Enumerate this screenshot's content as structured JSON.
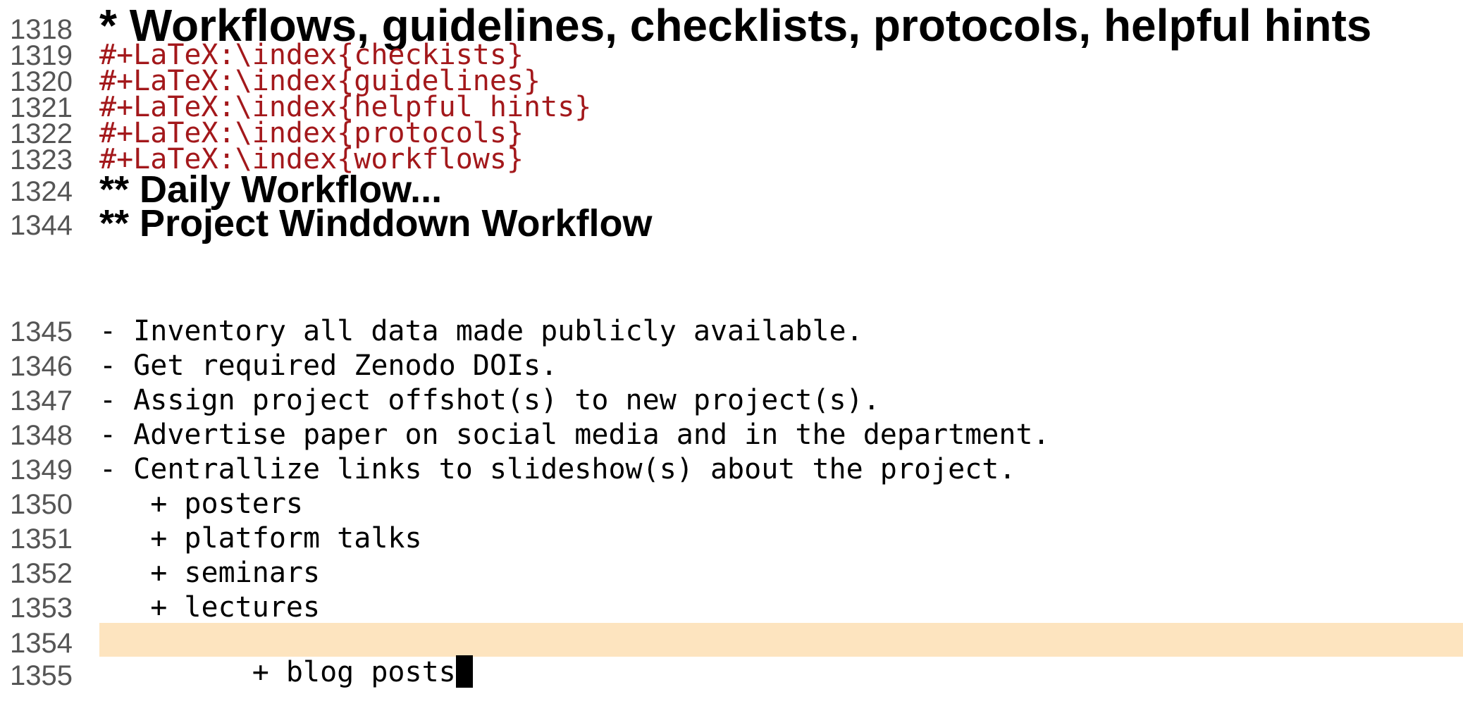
{
  "lines": [
    {
      "num": "1318",
      "text": "* Workflows, guidelines, checklists, protocols, helpful hints"
    },
    {
      "num": "1319",
      "text": "#+LaTeX:\\index{checkists}"
    },
    {
      "num": "1320",
      "text": "#+LaTeX:\\index{guidelines}"
    },
    {
      "num": "1321",
      "text": "#+LaTeX:\\index{helpful hints}"
    },
    {
      "num": "1322",
      "text": "#+LaTeX:\\index{protocols}"
    },
    {
      "num": "1323",
      "text": "#+LaTeX:\\index{workflows}"
    },
    {
      "num": "1324",
      "text": "** Daily Workflow..."
    },
    {
      "num": "1344",
      "text": "** Project Winddown Workflow"
    },
    {
      "num": "1345",
      "text": "- Inventory all data made publicly available."
    },
    {
      "num": "1346",
      "text": "- Get required Zenodo DOIs."
    },
    {
      "num": "1347",
      "text": "- Assign project offshot(s) to new project(s)."
    },
    {
      "num": "1348",
      "text": "- Advertise paper on social media and in the department."
    },
    {
      "num": "1349",
      "text": "- Centrallize links to slideshow(s) about the project."
    },
    {
      "num": "1350",
      "text": "   + posters"
    },
    {
      "num": "1351",
      "text": "   + platform talks"
    },
    {
      "num": "1352",
      "text": "   + seminars"
    },
    {
      "num": "1353",
      "text": "   + lectures"
    },
    {
      "num": "1354",
      "text": "   + blog posts"
    },
    {
      "num": "1355",
      "text": ""
    }
  ],
  "colors": {
    "latex_keyword": "#a3181b",
    "line_number": "#555555",
    "current_line_highlight": "#fde4bf",
    "cursor": "#000000"
  }
}
